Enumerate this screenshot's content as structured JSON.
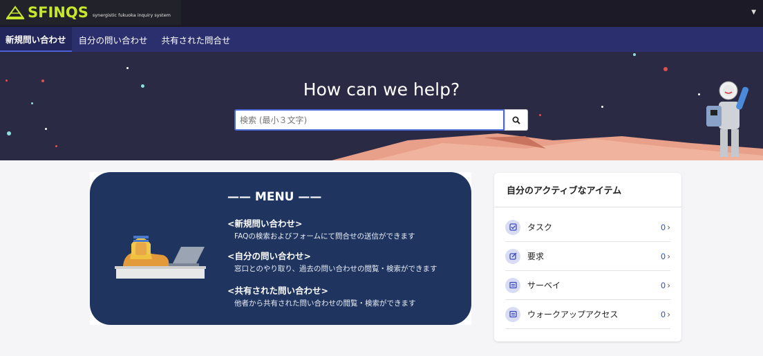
{
  "header": {
    "logo_text": "SFINQS",
    "logo_subtitle": "synergistic fukuoka inquiry system",
    "user_menu_icon": "caret-down-icon"
  },
  "nav": {
    "tabs": [
      {
        "label": "新規問い合わせ",
        "active": true
      },
      {
        "label": "自分の問い合わせ",
        "active": false
      },
      {
        "label": "共有された問合せ",
        "active": false
      }
    ]
  },
  "hero": {
    "title": "How can we help?",
    "search_placeholder": "検索 (最小３文字)",
    "search_icon": "search-icon"
  },
  "menu": {
    "title": "—— MENU ——",
    "items": [
      {
        "heading": "<新規問い合わせ>",
        "desc": "FAQの検索およびフォームにて問合せの送信ができます"
      },
      {
        "heading": "<自分の問い合わせ>",
        "desc": "窓口とのやり取り、過去の問い合わせの閲覧・検索ができます"
      },
      {
        "heading": "<共有された問い合わせ>",
        "desc": "他者から共有された問い合わせの閲覧・検索ができます"
      }
    ]
  },
  "active_items": {
    "title": "自分のアクティブなアイテム",
    "rows": [
      {
        "label": "タスク",
        "count": "0",
        "icon": "checkbox-icon"
      },
      {
        "label": "要求",
        "count": "0",
        "icon": "edit-icon"
      },
      {
        "label": "サーベイ",
        "count": "0",
        "icon": "list-icon"
      },
      {
        "label": "ウォークアップアクセス",
        "count": "0",
        "icon": "list-icon"
      }
    ]
  },
  "colors": {
    "topbar": "#1b1a26",
    "navbar": "#2c2f6e",
    "hero": "#2b2a44",
    "menu_bg": "#1f3560",
    "logo": "#c8e62a",
    "accent": "#3550c8"
  }
}
